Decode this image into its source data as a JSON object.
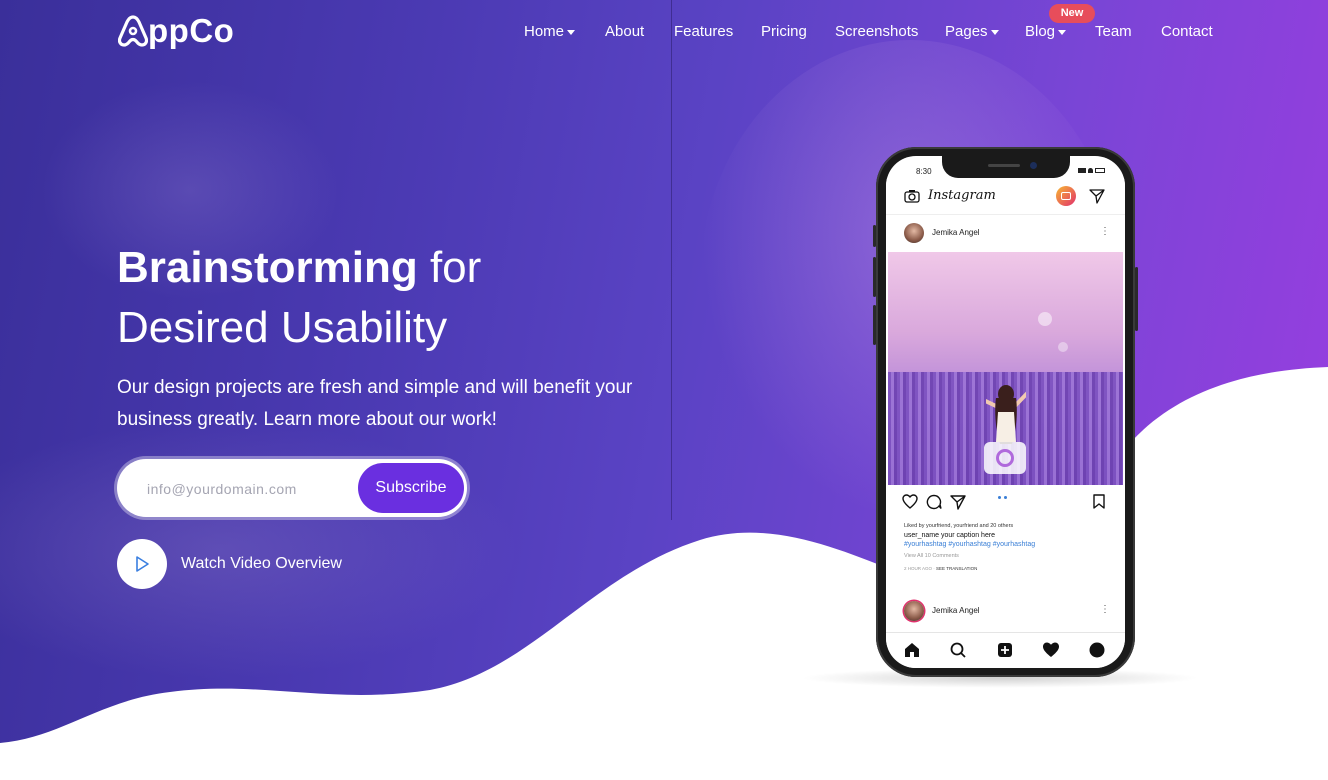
{
  "brand": {
    "name": "ppCo"
  },
  "nav": {
    "items": [
      {
        "label": "Home",
        "dropdown": true
      },
      {
        "label": "About",
        "dropdown": false
      },
      {
        "label": "Features",
        "dropdown": false
      },
      {
        "label": "Pricing",
        "dropdown": false
      },
      {
        "label": "Screenshots",
        "dropdown": false
      },
      {
        "label": "Pages",
        "dropdown": true
      },
      {
        "label": "Blog",
        "dropdown": true
      },
      {
        "label": "Team",
        "dropdown": false
      },
      {
        "label": "Contact",
        "dropdown": false
      }
    ],
    "badge": "New"
  },
  "hero": {
    "headline_bold": "Brainstorming",
    "headline_rest1": "for",
    "headline_line2": "Desired Usability",
    "subtext": "Our design projects are fresh and simple and will benefit your business greatly. Learn more about our work!",
    "email_placeholder": "info@yourdomain.com",
    "subscribe_label": "Subscribe",
    "watch_label": "Watch Video Overview"
  },
  "phone": {
    "time": "8:30",
    "app_name": "Instagram",
    "post_user": "Jemika Angel",
    "liked_by": "Liked by yourfriend, yourfriend and 20 others",
    "caption": "user_name  your caption here",
    "hashtags": "#yourhashtag #yourhashtag #yourhashtag",
    "view_comments": "View All 10 Comments",
    "time_ago": "2 HOUR AGO",
    "see_translation": "SEE TRANSLATION",
    "post2_user": "Jemika Angel"
  },
  "colors": {
    "accent": "#6a2fe0",
    "badge": "#e74d5b"
  }
}
